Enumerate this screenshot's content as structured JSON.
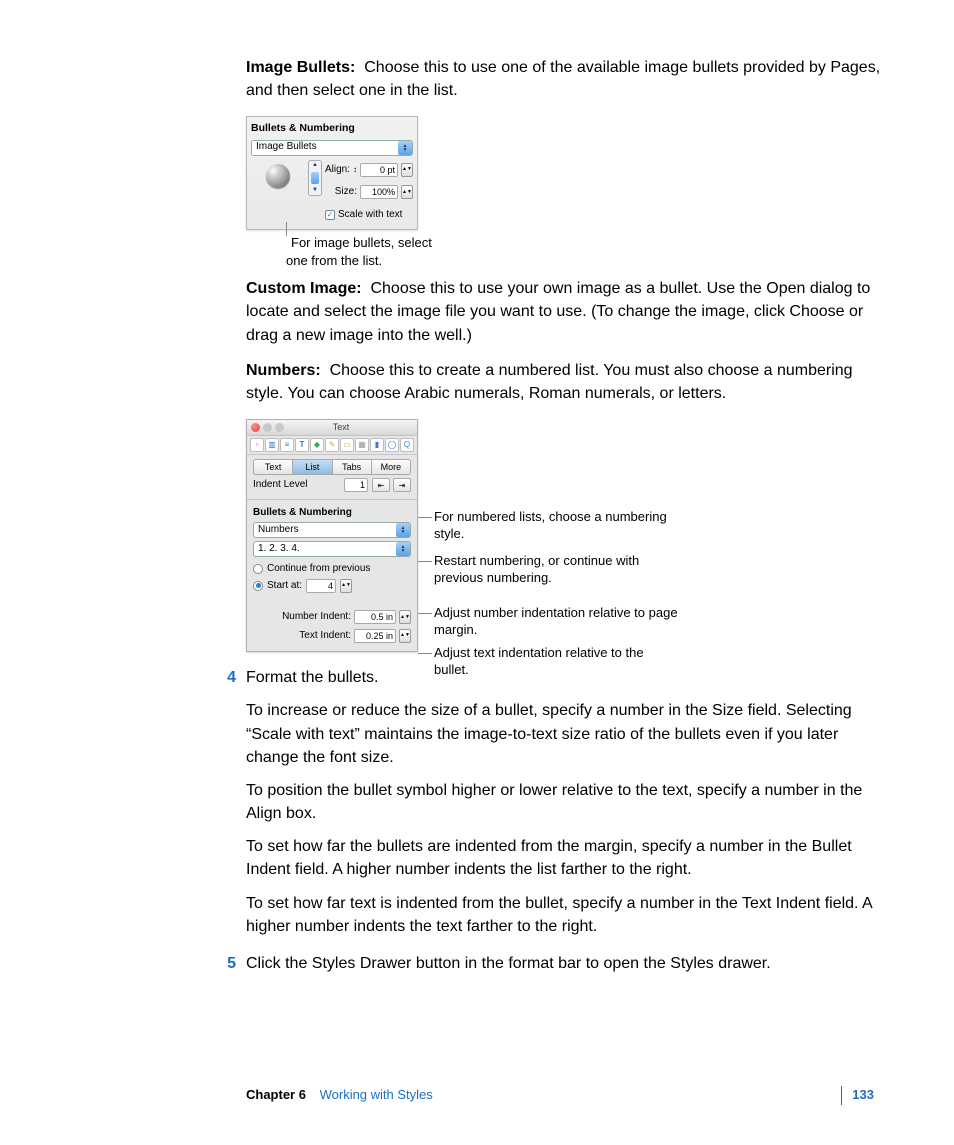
{
  "para_image_bullets_label": "Image Bullets:",
  "para_image_bullets_text": "Choose this to use one of the available image bullets provided by Pages, and then select one in the list.",
  "fig1": {
    "header": "Bullets & Numbering",
    "select_value": "Image Bullets",
    "align_label": "Align:",
    "align_value": "0 pt",
    "size_label": "Size:",
    "size_value": "100%",
    "scale_label": "Scale with text",
    "caption": "For image bullets, select one from the list."
  },
  "para_custom_label": "Custom Image:",
  "para_custom_text": "Choose this to use your own image as a bullet. Use the Open dialog to locate and select the image file you want to use. (To change the image, click Choose or drag a new image into the well.)",
  "para_numbers_label": "Numbers:",
  "para_numbers_text": "Choose this to create a numbered list. You must also choose a numbering style. You can choose Arabic numerals, Roman numerals, or letters.",
  "fig2": {
    "title": "Text",
    "tab_text": "Text",
    "tab_list": "List",
    "tab_tabs": "Tabs",
    "tab_more": "More",
    "indent_label": "Indent Level",
    "indent_value": "1",
    "bn_header": "Bullets & Numbering",
    "sel_numbers": "Numbers",
    "sel_style": "1.  2.  3.  4.",
    "continue_label": "Continue from previous",
    "start_label": "Start at:",
    "start_value": "4",
    "num_indent_label": "Number Indent:",
    "num_indent_value": "0.5 in",
    "text_indent_label": "Text Indent:",
    "text_indent_value": "0.25 in",
    "callout_style": "For numbered lists, choose a numbering style.",
    "callout_restart": "Restart numbering, or continue with previous numbering.",
    "callout_numind": "Adjust number indentation relative to page margin.",
    "callout_txtind": "Adjust text indentation relative to the bullet."
  },
  "step4_num": "4",
  "step4": "Format the bullets.",
  "step4_p1": "To increase or reduce the size of a bullet, specify a number in the Size field. Selecting “Scale with text” maintains the image-to-text size ratio of the bullets even if you later change the font size.",
  "step4_p2": "To position the bullet symbol higher or lower relative to the text, specify a number in the Align box.",
  "step4_p3": "To set how far the bullets are indented from the margin, specify a number in the Bullet Indent field. A higher number indents the list farther to the right.",
  "step4_p4": "To set how far text is indented from the bullet, specify a number in the Text Indent field. A higher number indents the text farther to the right.",
  "step5_num": "5",
  "step5": "Click the Styles Drawer button in the format bar to open the Styles drawer.",
  "footer": {
    "chapter": "Chapter 6",
    "title": "Working with Styles",
    "page": "133"
  }
}
